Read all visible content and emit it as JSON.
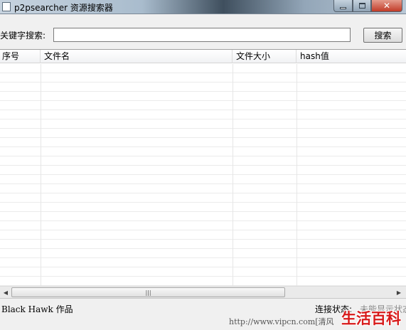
{
  "window": {
    "title": "p2psearcher 资源搜索器",
    "controls": {
      "minimize": "minimize",
      "maximize": "maximize",
      "close": "x"
    }
  },
  "search": {
    "label": "关键字搜索:",
    "value": "",
    "button_label": "搜索"
  },
  "table": {
    "columns": [
      "序号",
      "文件名",
      "文件大小",
      "hash值"
    ],
    "rows": []
  },
  "scrollbar": {
    "thumb_grip": "|||"
  },
  "status": {
    "author": "Black Hawk 作品",
    "connection_label": "连接状态:",
    "connection_value": "未能显示状态"
  },
  "watermark": {
    "url": "http://www.vipcn.com[清风",
    "logo": "生活百科"
  },
  "colors": {
    "close_button": "#c13b27",
    "watermark_logo": "#d71a1a"
  }
}
